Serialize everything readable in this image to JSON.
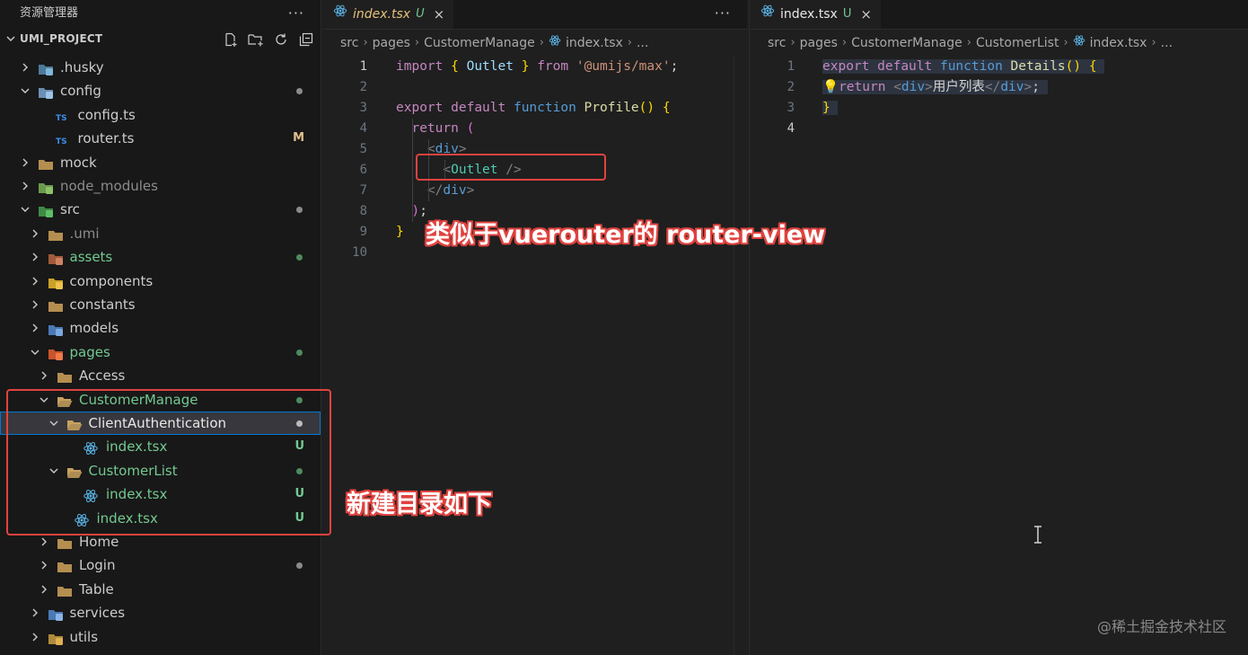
{
  "explorer": {
    "title": "资源管理器",
    "more": "···",
    "project": "UMI_PROJECT",
    "items": [
      {
        "label": "",
        "label_text": ".husky",
        "depth": 1,
        "open": false,
        "icon": "folder-husky-icon",
        "color": "#cccccc",
        "status": "",
        "dot": ""
      },
      {
        "label_text": "config",
        "depth": 1,
        "open": true,
        "icon": "folder-config-icon",
        "color": "#cccccc",
        "status": "",
        "dot": "#8a8a8a"
      },
      {
        "label_text": "config.ts",
        "depth": 2,
        "file": true,
        "icon": "typescript-icon",
        "color": "#cccccc",
        "status": "",
        "dot": ""
      },
      {
        "label_text": "router.ts",
        "depth": 2,
        "file": true,
        "icon": "typescript-icon",
        "color": "#cccccc",
        "status": "M",
        "dot": ""
      },
      {
        "label_text": "mock",
        "depth": 1,
        "open": false,
        "icon": "folder-icon",
        "color": "#cccccc",
        "status": "",
        "dot": ""
      },
      {
        "label_text": "node_modules",
        "depth": 1,
        "open": false,
        "icon": "folder-node-icon",
        "color": "#8c8c8c",
        "status": "",
        "dot": ""
      },
      {
        "label_text": "src",
        "depth": 1,
        "open": true,
        "icon": "folder-src-icon",
        "color": "#cccccc",
        "status": "",
        "dot": "#8a8a8a"
      },
      {
        "label_text": ".umi",
        "depth": 2,
        "open": false,
        "icon": "folder-icon",
        "color": "#8c8c8c",
        "status": "",
        "dot": ""
      },
      {
        "label_text": "assets",
        "depth": 2,
        "open": false,
        "icon": "folder-assets-icon",
        "color": "#73c991",
        "status": "",
        "dot": "#4f8a5e"
      },
      {
        "label_text": "components",
        "depth": 2,
        "open": false,
        "icon": "folder-components-icon",
        "color": "#cccccc",
        "status": "",
        "dot": ""
      },
      {
        "label_text": "constants",
        "depth": 2,
        "open": false,
        "icon": "folder-icon",
        "color": "#cccccc",
        "status": "",
        "dot": ""
      },
      {
        "label_text": "models",
        "depth": 2,
        "open": false,
        "icon": "folder-models-icon",
        "color": "#cccccc",
        "status": "",
        "dot": ""
      },
      {
        "label_text": "pages",
        "depth": 2,
        "open": true,
        "icon": "folder-pages-icon",
        "color": "#73c991",
        "status": "",
        "dot": "#4f8a5e"
      },
      {
        "label_text": "Access",
        "depth": 3,
        "open": false,
        "icon": "folder-icon",
        "color": "#cccccc",
        "status": "",
        "dot": ""
      },
      {
        "label_text": "CustomerManage",
        "depth": 3,
        "open": true,
        "icon": "folder-open-icon",
        "color": "#73c991",
        "status": "",
        "dot": "#4f8a5e"
      },
      {
        "label_text": "ClientAuthentication",
        "depth": 4,
        "open": true,
        "icon": "folder-open-icon",
        "color": "#e8e8e8",
        "status": "",
        "dot": "#bbbbbb",
        "selected": true
      },
      {
        "label_text": "index.tsx",
        "depth": 5,
        "file": true,
        "icon": "react-icon",
        "color": "#73c991",
        "status": "U",
        "dot": ""
      },
      {
        "label_text": "CustomerList",
        "depth": 4,
        "open": true,
        "icon": "folder-open-icon",
        "color": "#73c991",
        "status": "",
        "dot": "#4f8a5e"
      },
      {
        "label_text": "index.tsx",
        "depth": 5,
        "file": true,
        "icon": "react-icon",
        "color": "#73c991",
        "status": "U",
        "dot": ""
      },
      {
        "label_text": "index.tsx",
        "depth": 4,
        "file": true,
        "icon": "react-icon",
        "color": "#73c991",
        "status": "U",
        "dot": ""
      },
      {
        "label_text": "Home",
        "depth": 3,
        "open": false,
        "icon": "folder-icon",
        "color": "#cccccc",
        "status": "",
        "dot": ""
      },
      {
        "label_text": "Login",
        "depth": 3,
        "open": false,
        "icon": "folder-icon",
        "color": "#cccccc",
        "status": "",
        "dot": "#8a8a8a"
      },
      {
        "label_text": "Table",
        "depth": 3,
        "open": false,
        "icon": "folder-icon",
        "color": "#cccccc",
        "status": "",
        "dot": ""
      },
      {
        "label_text": "services",
        "depth": 2,
        "open": false,
        "icon": "folder-services-icon",
        "color": "#cccccc",
        "status": "",
        "dot": ""
      },
      {
        "label_text": "utils",
        "depth": 2,
        "open": false,
        "icon": "folder-utils-icon",
        "color": "#cccccc",
        "status": "",
        "dot": ""
      }
    ]
  },
  "editor1": {
    "tab": {
      "name": "index.tsx",
      "status": "U",
      "close": "×"
    },
    "more": "···",
    "breadcrumbs": [
      "src",
      "pages",
      "CustomerManage",
      "index.tsx",
      "..."
    ],
    "line_numbers": [
      "1",
      "2",
      "3",
      "4",
      "5",
      "6",
      "7",
      "8",
      "9",
      "10"
    ],
    "active_line": "1"
  },
  "editor2": {
    "tab": {
      "name": "index.tsx",
      "status": "U",
      "close": "×"
    },
    "breadcrumbs": [
      "src",
      "pages",
      "CustomerManage",
      "CustomerList",
      "index.tsx",
      "..."
    ],
    "line_numbers": [
      "1",
      "2",
      "3",
      "4"
    ],
    "active_line": "4"
  },
  "annotations": {
    "router_view": "类似于vuerouter的 router-view",
    "new_dir": "新建目录如下"
  },
  "watermark": "@稀土掘金技术社区",
  "colors": {
    "accent_red": "#e0433f",
    "git_untracked": "#73c991",
    "selection": "#0078d4"
  }
}
